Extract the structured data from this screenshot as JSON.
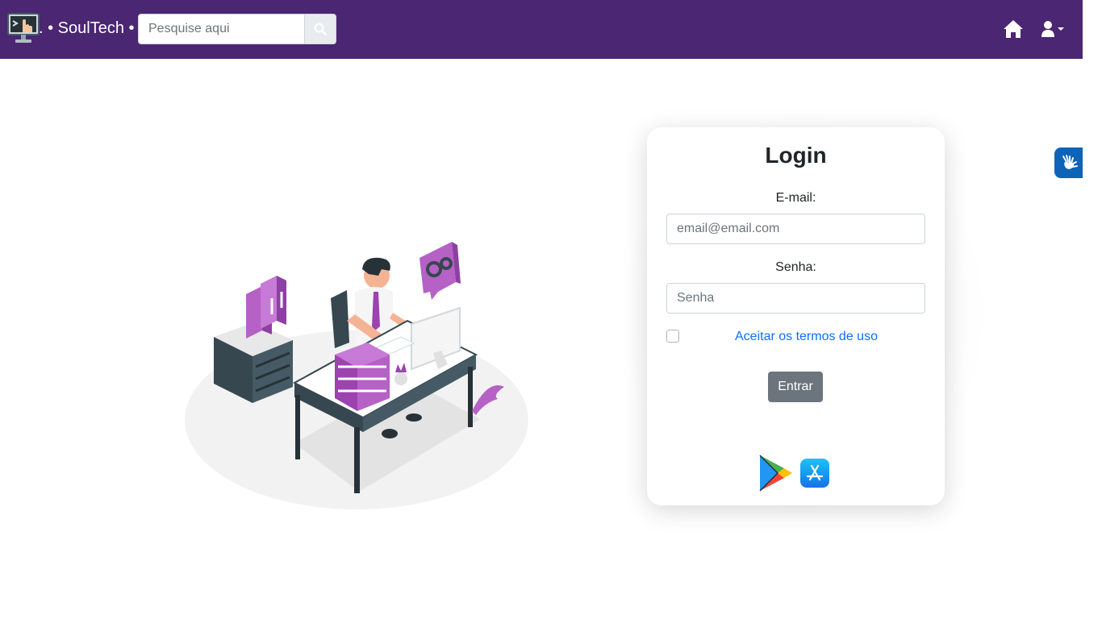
{
  "navbar": {
    "brand": ". • SoulTech •",
    "search_placeholder": "Pesquise aqui",
    "background_color": "#4b2672"
  },
  "icons": {
    "logo": "computer-hand-logo",
    "search": "search-icon",
    "home": "home-icon",
    "user": "user-icon",
    "accessibility": "sign-language-icon"
  },
  "login": {
    "title": "Login",
    "email_label": "E-mail:",
    "email_placeholder": "email@email.com",
    "password_label": "Senha:",
    "password_placeholder": "Senha",
    "terms_text": "Aceitar os termos de uso",
    "terms_checked": false,
    "submit_label": "Entrar",
    "link_color": "#0d6efd",
    "button_color": "#6c757d"
  },
  "stores": {
    "google_play": "google-play-icon",
    "app_store": "app-store-icon"
  }
}
